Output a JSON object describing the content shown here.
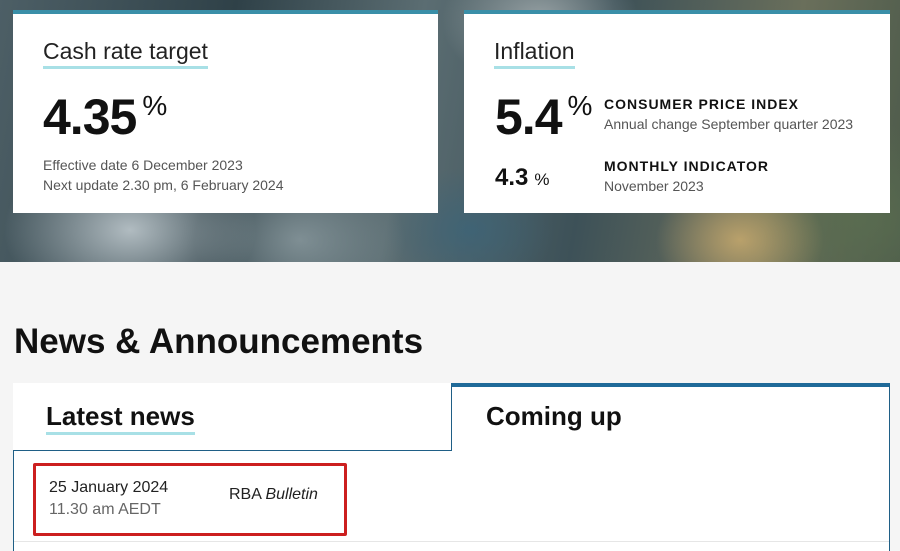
{
  "cash_rate": {
    "title": "Cash rate target",
    "value": "4.35",
    "unit": "%",
    "effective": "Effective date 6 December 2023",
    "next_update": "Next update 2.30 pm, 6 February 2024"
  },
  "inflation": {
    "title": "Inflation",
    "cpi_value": "5.4",
    "cpi_unit": "%",
    "cpi_label": "CONSUMER PRICE INDEX",
    "cpi_desc": "Annual change September quarter 2023",
    "monthly_value": "4.3",
    "monthly_unit": "%",
    "monthly_label": "MONTHLY INDICATOR",
    "monthly_desc": "November 2023"
  },
  "news": {
    "section_title": "News & Announcements",
    "tabs": [
      {
        "label": "Latest news"
      },
      {
        "label": "Coming up"
      }
    ],
    "events": [
      {
        "date": "25 January 2024",
        "time": "11.30 am AEDT",
        "title_prefix": "RBA ",
        "title_italic": "Bulletin"
      }
    ]
  },
  "colors": {
    "accent_teal": "#3a8fa8",
    "underline": "#a8e0e6",
    "tab_blue": "#1f6a99",
    "highlight_red": "#cc1f1f"
  }
}
